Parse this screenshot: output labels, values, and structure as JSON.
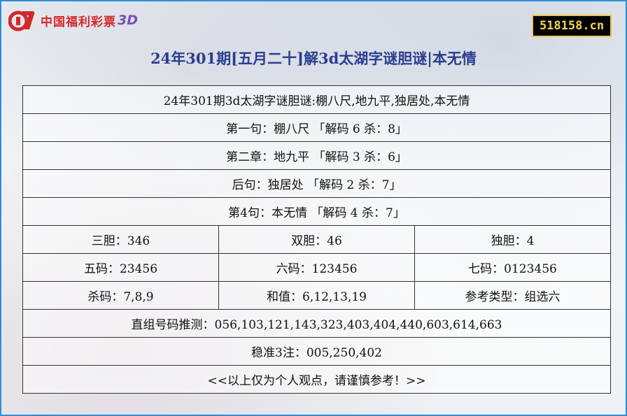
{
  "logo": {
    "text": "中国福利彩票",
    "suffix": "3D"
  },
  "site_badge": "518158.cn",
  "title": "24年301期[五月二十]解3d太湖字谜胆谜|本无情",
  "rows": {
    "riddle": "24年301期3d太湖字谜胆谜:棚八尺,地九平,独居处,本无情",
    "line1": "第一句：棚八尺 「解码 6 杀：8」",
    "line2": "第二章：地九平 「解码 3 杀：6」",
    "line3": "后句：独居处 「解码 2 杀：7」",
    "line4": "第4句：本无情 「解码 4 杀：7」",
    "three_dan": "三胆：346",
    "two_dan": "双胆：46",
    "one_dan": "独胆：4",
    "five_code": "五码：23456",
    "six_code": "六码：123456",
    "seven_code": "七码：0123456",
    "kill_code": "杀码：7,8,9",
    "sum_value": "和值：6,12,13,19",
    "ref_type": "参考类型：组选六",
    "direct_guess": "直组号码推测：056,103,121,143,323,403,404,440,603,614,663",
    "stable_three": "稳准3注：005,250,402",
    "disclaimer": "<<以上仅为个人观点，请谨慎参考！>>"
  }
}
